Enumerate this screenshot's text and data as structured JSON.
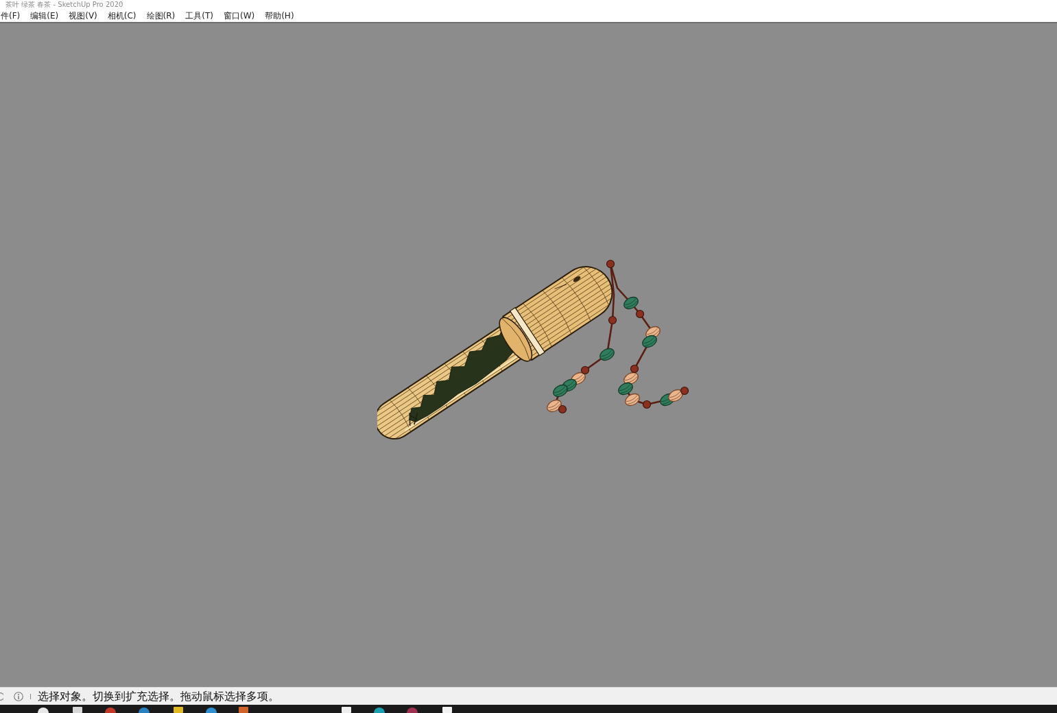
{
  "window": {
    "title": "茶叶 绿茶 春茶 - SketchUp Pro 2020"
  },
  "menu_bar": {
    "items": [
      "件(F)",
      "编辑(E)",
      "视图(V)",
      "相机(C)",
      "绘图(R)",
      "工具(T)",
      "窗口(W)",
      "帮助(H)"
    ]
  },
  "status_bar": {
    "text": "选择对象。切换到扩充选择。拖动鼠标选择多项。"
  }
}
